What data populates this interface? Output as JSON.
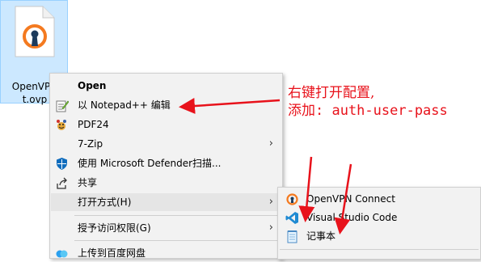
{
  "desktop_file": {
    "name_line1": "OpenVPN",
    "name_line2": "t.ovp"
  },
  "context_menu": {
    "items": [
      {
        "label": "Open",
        "bold": true
      },
      {
        "label": "以 Notepad++ 编辑"
      },
      {
        "label": "PDF24"
      },
      {
        "label": "7-Zip"
      },
      {
        "label": "使用 Microsoft Defender扫描..."
      },
      {
        "label": "共享"
      },
      {
        "label": "打开方式(H)"
      },
      {
        "label": "授予访问权限(G)"
      },
      {
        "label": "上传到百度网盘"
      }
    ]
  },
  "submenu": {
    "items": [
      {
        "label": "OpenVPN Connect"
      },
      {
        "label": "Visual Studio Code"
      },
      {
        "label": "记事本"
      }
    ]
  },
  "annotation": {
    "line1": "右键打开配置,",
    "line2": "添加: auth-user-pass",
    "color": "#e8121b"
  }
}
